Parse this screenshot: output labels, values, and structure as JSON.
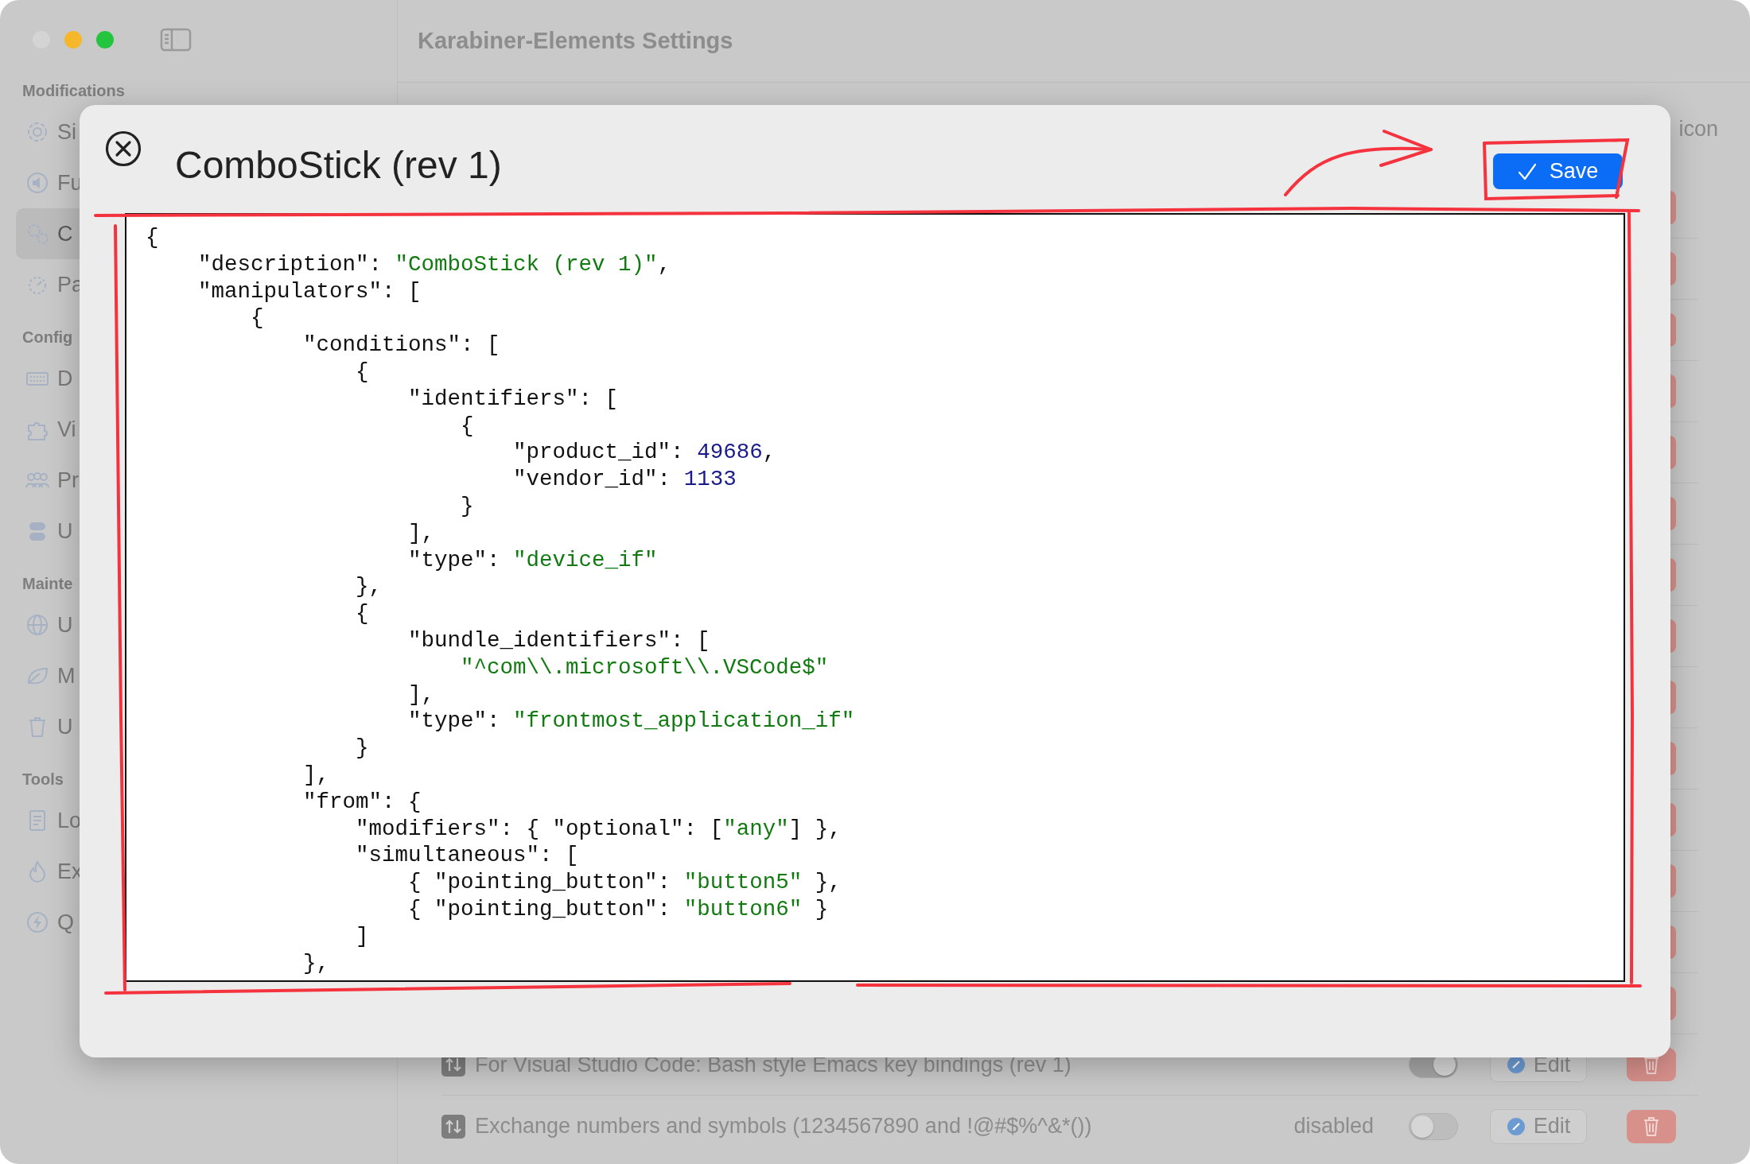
{
  "window": {
    "title": "Karabiner-Elements Settings"
  },
  "sidebar": {
    "sections": [
      {
        "header": "Modifications",
        "items": [
          {
            "label": "Si",
            "selected": false
          },
          {
            "label": "Fu",
            "selected": false
          },
          {
            "label": "C",
            "selected": true
          },
          {
            "label": "Pa",
            "selected": false
          }
        ]
      },
      {
        "header": "Config",
        "items": [
          {
            "label": "D",
            "selected": false
          },
          {
            "label": "Vi",
            "selected": false
          },
          {
            "label": "Pr",
            "selected": false
          },
          {
            "label": "U",
            "selected": false
          }
        ]
      },
      {
        "header": "Mainte",
        "items": [
          {
            "label": "U",
            "selected": false
          },
          {
            "label": "M",
            "selected": false
          },
          {
            "label": "U",
            "selected": false
          }
        ]
      },
      {
        "header": "Tools",
        "items": [
          {
            "label": "Lo",
            "selected": false
          },
          {
            "label": "Ex",
            "selected": false
          },
          {
            "label": "Q",
            "selected": false
          }
        ]
      }
    ]
  },
  "rules": {
    "column_header": "icon",
    "rows": [
      {
        "kind": "covered"
      },
      {
        "kind": "covered"
      },
      {
        "kind": "covered"
      },
      {
        "kind": "covered"
      },
      {
        "kind": "covered"
      },
      {
        "kind": "covered"
      },
      {
        "kind": "covered"
      },
      {
        "kind": "covered"
      },
      {
        "kind": "covered"
      },
      {
        "kind": "covered"
      },
      {
        "kind": "covered"
      },
      {
        "kind": "covered"
      },
      {
        "kind": "covered"
      },
      {
        "kind": "covered"
      },
      {
        "kind": "rule",
        "name": "For Visual Studio Code: Bash style Emacs key bindings (rev 1)",
        "on": true,
        "edit": "Edit"
      },
      {
        "kind": "rule",
        "name": "Exchange numbers and symbols (1234567890 and !@#$%^&*())",
        "status": "disabled",
        "on": false,
        "edit": "Edit"
      }
    ]
  },
  "dialog": {
    "title": "ComboStick (rev 1)",
    "save": "Save",
    "editor": {
      "lines": [
        [
          {
            "kind": "plain",
            "text": "{"
          }
        ],
        [
          {
            "kind": "plain",
            "text": "    \"description\": "
          },
          {
            "kind": "string",
            "text": "\"ComboStick (rev 1)\""
          },
          {
            "kind": "plain",
            "text": ","
          }
        ],
        [
          {
            "kind": "plain",
            "text": "    \"manipulators\": ["
          }
        ],
        [
          {
            "kind": "plain",
            "text": "        {"
          }
        ],
        [
          {
            "kind": "plain",
            "text": "            \"conditions\": ["
          }
        ],
        [
          {
            "kind": "plain",
            "text": "                {"
          }
        ],
        [
          {
            "kind": "plain",
            "text": "                    \"identifiers\": ["
          }
        ],
        [
          {
            "kind": "plain",
            "text": "                        {"
          }
        ],
        [
          {
            "kind": "plain",
            "text": "                            \"product_id\": "
          },
          {
            "kind": "number",
            "text": "49686"
          },
          {
            "kind": "plain",
            "text": ","
          }
        ],
        [
          {
            "kind": "plain",
            "text": "                            \"vendor_id\": "
          },
          {
            "kind": "number",
            "text": "1133"
          }
        ],
        [
          {
            "kind": "plain",
            "text": "                        }"
          }
        ],
        [
          {
            "kind": "plain",
            "text": "                    ],"
          }
        ],
        [
          {
            "kind": "plain",
            "text": "                    \"type\": "
          },
          {
            "kind": "string",
            "text": "\"device_if\""
          }
        ],
        [
          {
            "kind": "plain",
            "text": "                },"
          }
        ],
        [
          {
            "kind": "plain",
            "text": "                {"
          }
        ],
        [
          {
            "kind": "plain",
            "text": "                    \"bundle_identifiers\": ["
          }
        ],
        [
          {
            "kind": "string",
            "text": "                        \"^com\\\\.microsoft\\\\.VSCode$\""
          }
        ],
        [
          {
            "kind": "plain",
            "text": "                    ],"
          }
        ],
        [
          {
            "kind": "plain",
            "text": "                    \"type\": "
          },
          {
            "kind": "string",
            "text": "\"frontmost_application_if\""
          }
        ],
        [
          {
            "kind": "plain",
            "text": "                }"
          }
        ],
        [
          {
            "kind": "plain",
            "text": "            ],"
          }
        ],
        [
          {
            "kind": "plain",
            "text": "            \"from\": {"
          }
        ],
        [
          {
            "kind": "plain",
            "text": "                \"modifiers\": { \"optional\": ["
          },
          {
            "kind": "string",
            "text": "\"any\""
          },
          {
            "kind": "plain",
            "text": "] },"
          }
        ],
        [
          {
            "kind": "plain",
            "text": "                \"simultaneous\": ["
          }
        ],
        [
          {
            "kind": "plain",
            "text": "                    { \"pointing_button\": "
          },
          {
            "kind": "string",
            "text": "\"button5\""
          },
          {
            "kind": "plain",
            "text": " },"
          }
        ],
        [
          {
            "kind": "plain",
            "text": "                    { \"pointing_button\": "
          },
          {
            "kind": "string",
            "text": "\"button6\""
          },
          {
            "kind": "plain",
            "text": " }"
          }
        ],
        [
          {
            "kind": "plain",
            "text": "                ]"
          }
        ],
        [
          {
            "kind": "plain",
            "text": "            },"
          }
        ]
      ]
    }
  }
}
